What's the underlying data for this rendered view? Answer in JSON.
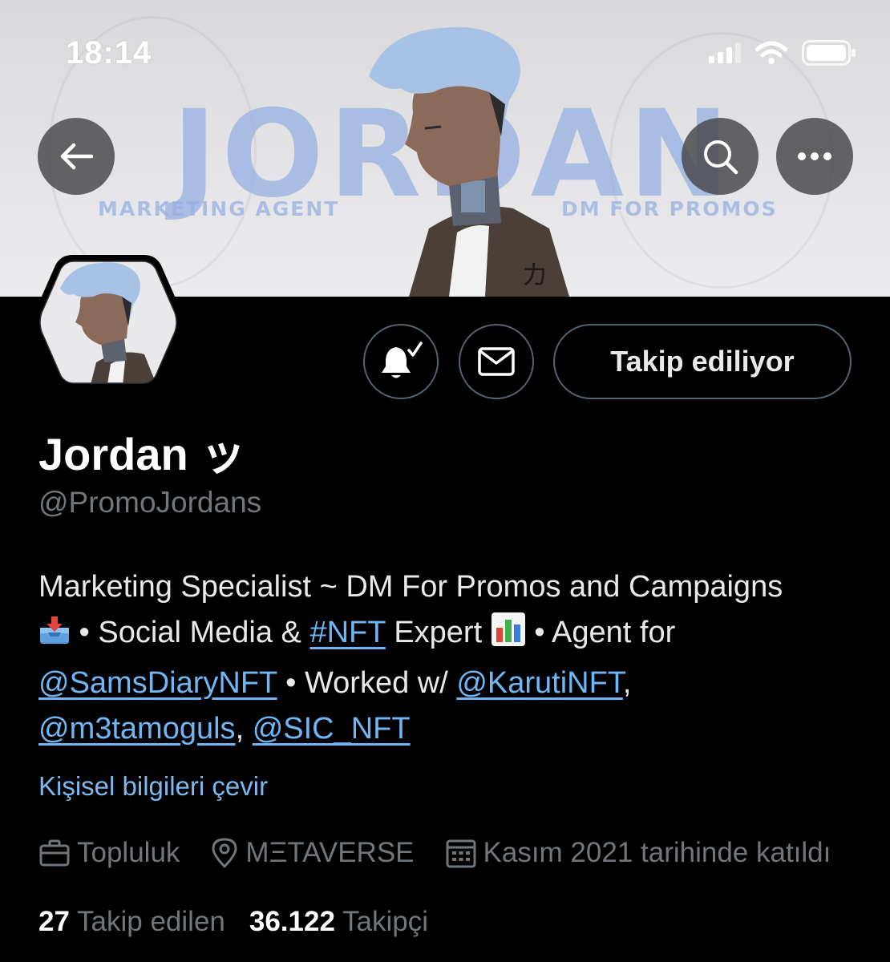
{
  "status_bar": {
    "time": "18:14"
  },
  "banner": {
    "title": "JORDAN",
    "subtitle_left": "MARKETING AGENT",
    "subtitle_right": "DM FOR PROMOS"
  },
  "top_buttons": {
    "back_icon": "arrow-left-icon",
    "search_icon": "search-icon",
    "more_icon": "more-horizontal-icon"
  },
  "actions": {
    "notification_icon": "bell-check-icon",
    "message_icon": "envelope-icon",
    "follow_label": "Takip ediliyor"
  },
  "profile": {
    "display_name": "Jordan ッ",
    "handle": "@PromoJordans"
  },
  "bio": {
    "line1": "Marketing Specialist ~ DM For Promos and Campaigns",
    "inbox_emoji": "inbox-tray-emoji",
    "part_social": " • Social Media & ",
    "hashtag": "#NFT",
    "part_expert": " Expert ",
    "chart_emoji": "bar-chart-emoji",
    "part_agent": " • Agent for",
    "mention_sams": "@SamsDiaryNFT",
    "part_worked": " • Worked w/ ",
    "mention_karuti": "@KarutiNFT",
    "comma1": ",",
    "mention_m3": "@m3tamoguls",
    "comma2": ", ",
    "mention_sic": "@SIC_NFT"
  },
  "translate_label": "Kişisel bilgileri çevir",
  "meta": {
    "category": "Topluluk",
    "location": "MΞTAVERSE",
    "joined": "Kasım 2021 tarihinde katıldı"
  },
  "stats": {
    "following_count": "27",
    "following_label": "Takip edilen",
    "followers_count": "36.122",
    "followers_label": "Takipçi"
  }
}
